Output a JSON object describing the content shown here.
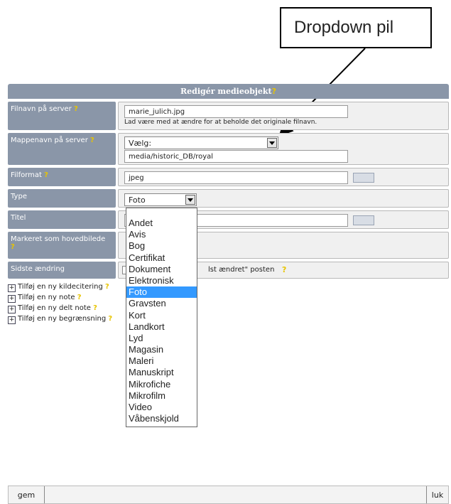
{
  "annotation": {
    "text": "Dropdown pil"
  },
  "dialog": {
    "title": "Redigér medieobjekt"
  },
  "fields": {
    "filename": {
      "label": "Filnavn på server",
      "value": "marie_julich.jpg",
      "hint": "Lad være med at ændre for at beholde det originale filnavn."
    },
    "folder": {
      "label": "Mappenavn på server",
      "select_value": "Vælg:",
      "value": "media/historic_DB/royal"
    },
    "format": {
      "label": "Filformat",
      "value": "jpeg"
    },
    "type": {
      "label": "Type",
      "select_value": "Foto"
    },
    "title": {
      "label": "Titel",
      "value": ""
    },
    "primary": {
      "label": "Markeret som hovedbilede"
    },
    "last_change": {
      "label": "Sidste ændring",
      "text": "lst ændret\" posten"
    }
  },
  "links": [
    "Tilføj en ny kildecitering",
    "Tilføj en ny note",
    "Tilføj en ny delt note",
    "Tilføj en ny begrænsning"
  ],
  "type_options": [
    "Andet",
    "Avis",
    "Bog",
    "Certifikat",
    "Dokument",
    "Elektronisk",
    "Foto",
    "Gravsten",
    "Kort",
    "Landkort",
    "Lyd",
    "Magasin",
    "Maleri",
    "Manuskript",
    "Mikrofiche",
    "Mikrofilm",
    "Video",
    "Våbenskjold"
  ],
  "type_selected": "Foto",
  "footer": {
    "save": "gem",
    "close": "luk"
  },
  "colors": {
    "header_bg": "#8a96a8",
    "selected_bg": "#3399ff",
    "help_icon": "#e8c400"
  }
}
